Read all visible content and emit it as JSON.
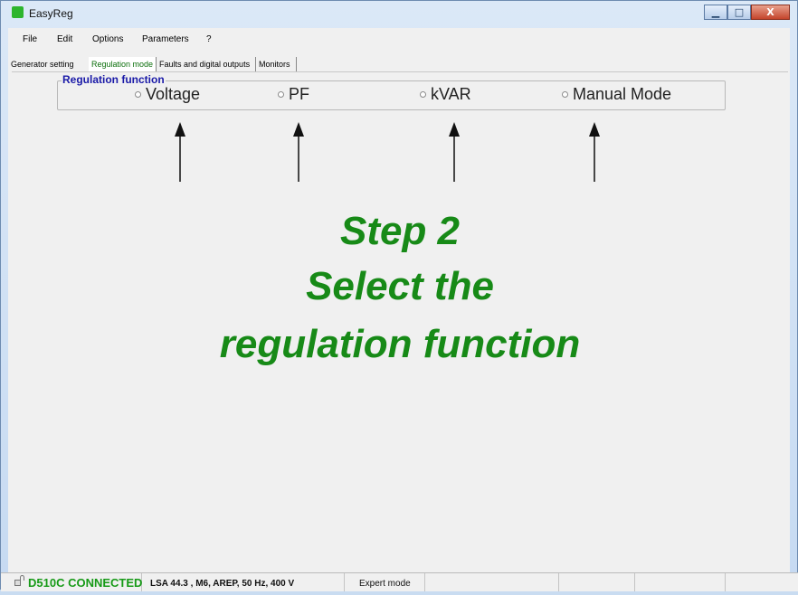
{
  "window": {
    "title": "EasyReg",
    "min_label": "▁",
    "max_label": "□",
    "close_label": "X"
  },
  "menu": [
    "File",
    "Edit",
    "Options",
    "Parameters",
    "?"
  ],
  "tabs": [
    {
      "label": "Generator setting",
      "active": false
    },
    {
      "label": "Regulation mode",
      "active": true
    },
    {
      "label": "Faults and digital outputs",
      "active": false
    },
    {
      "label": "Monitors",
      "active": false
    }
  ],
  "regulation": {
    "group_label": "Regulation function",
    "options": [
      "Voltage",
      "PF",
      "kVAR",
      "Manual Mode"
    ],
    "selected": null
  },
  "overlay": {
    "lines": [
      "Step 2",
      "Select the",
      "regulation function"
    ],
    "color": "#178a17"
  },
  "status": {
    "connection": "D510C CONNECTED",
    "device": "LSA 44.3   , M6, AREP, 50 Hz, 400 V",
    "mode": "Expert mode"
  }
}
